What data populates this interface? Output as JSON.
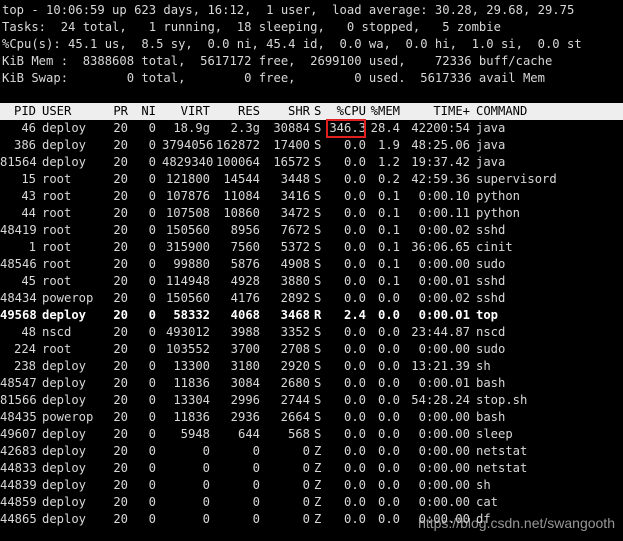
{
  "summary": {
    "line1": "top - 10:06:59 up 623 days, 16:12,  1 user,  load average: 30.28, 29.68, 29.75",
    "line2": "Tasks:  24 total,   1 running,  18 sleeping,   0 stopped,   5 zombie",
    "line3": "%Cpu(s): 45.1 us,  8.5 sy,  0.0 ni, 45.4 id,  0.0 wa,  0.0 hi,  1.0 si,  0.0 st",
    "line4": "KiB Mem :  8388608 total,  5617172 free,  2699100 used,    72336 buff/cache",
    "line5": "KiB Swap:        0 total,        0 free,        0 used.  5617336 avail Mem"
  },
  "columns": {
    "pid": "PID",
    "user": "USER",
    "pr": "PR",
    "ni": "NI",
    "virt": "VIRT",
    "res": "RES",
    "shr": "SHR",
    "s": "S",
    "cpu": "%CPU",
    "mem": "%MEM",
    "time": "TIME+",
    "command": "COMMAND"
  },
  "processes": [
    {
      "pid": "46",
      "user": "deploy",
      "pr": "20",
      "ni": "0",
      "virt": "18.9g",
      "res": "2.3g",
      "shr": "30884",
      "s": "S",
      "cpu": "346.3",
      "mem": "28.4",
      "time": "42200:54",
      "command": "java"
    },
    {
      "pid": "386",
      "user": "deploy",
      "pr": "20",
      "ni": "0",
      "virt": "3794056",
      "res": "162872",
      "shr": "17400",
      "s": "S",
      "cpu": "0.0",
      "mem": "1.9",
      "time": "48:25.06",
      "command": "java"
    },
    {
      "pid": "81564",
      "user": "deploy",
      "pr": "20",
      "ni": "0",
      "virt": "4829340",
      "res": "100064",
      "shr": "16572",
      "s": "S",
      "cpu": "0.0",
      "mem": "1.2",
      "time": "19:37.42",
      "command": "java"
    },
    {
      "pid": "15",
      "user": "root",
      "pr": "20",
      "ni": "0",
      "virt": "121800",
      "res": "14544",
      "shr": "3448",
      "s": "S",
      "cpu": "0.0",
      "mem": "0.2",
      "time": "42:59.36",
      "command": "supervisord"
    },
    {
      "pid": "43",
      "user": "root",
      "pr": "20",
      "ni": "0",
      "virt": "107876",
      "res": "11084",
      "shr": "3416",
      "s": "S",
      "cpu": "0.0",
      "mem": "0.1",
      "time": "0:00.10",
      "command": "python"
    },
    {
      "pid": "44",
      "user": "root",
      "pr": "20",
      "ni": "0",
      "virt": "107508",
      "res": "10860",
      "shr": "3472",
      "s": "S",
      "cpu": "0.0",
      "mem": "0.1",
      "time": "0:00.11",
      "command": "python"
    },
    {
      "pid": "48419",
      "user": "root",
      "pr": "20",
      "ni": "0",
      "virt": "150560",
      "res": "8956",
      "shr": "7672",
      "s": "S",
      "cpu": "0.0",
      "mem": "0.1",
      "time": "0:00.02",
      "command": "sshd"
    },
    {
      "pid": "1",
      "user": "root",
      "pr": "20",
      "ni": "0",
      "virt": "315900",
      "res": "7560",
      "shr": "5372",
      "s": "S",
      "cpu": "0.0",
      "mem": "0.1",
      "time": "36:06.65",
      "command": "cinit"
    },
    {
      "pid": "48546",
      "user": "root",
      "pr": "20",
      "ni": "0",
      "virt": "99880",
      "res": "5876",
      "shr": "4908",
      "s": "S",
      "cpu": "0.0",
      "mem": "0.1",
      "time": "0:00.00",
      "command": "sudo"
    },
    {
      "pid": "45",
      "user": "root",
      "pr": "20",
      "ni": "0",
      "virt": "114948",
      "res": "4928",
      "shr": "3880",
      "s": "S",
      "cpu": "0.0",
      "mem": "0.1",
      "time": "0:00.01",
      "command": "sshd"
    },
    {
      "pid": "48434",
      "user": "powerop",
      "pr": "20",
      "ni": "0",
      "virt": "150560",
      "res": "4176",
      "shr": "2892",
      "s": "S",
      "cpu": "0.0",
      "mem": "0.0",
      "time": "0:00.02",
      "command": "sshd"
    },
    {
      "pid": "49568",
      "user": "deploy",
      "pr": "20",
      "ni": "0",
      "virt": "58332",
      "res": "4068",
      "shr": "3468",
      "s": "R",
      "cpu": "2.4",
      "mem": "0.0",
      "time": "0:00.01",
      "command": "top"
    },
    {
      "pid": "48",
      "user": "nscd",
      "pr": "20",
      "ni": "0",
      "virt": "493012",
      "res": "3988",
      "shr": "3352",
      "s": "S",
      "cpu": "0.0",
      "mem": "0.0",
      "time": "23:44.87",
      "command": "nscd"
    },
    {
      "pid": "224",
      "user": "root",
      "pr": "20",
      "ni": "0",
      "virt": "103552",
      "res": "3700",
      "shr": "2708",
      "s": "S",
      "cpu": "0.0",
      "mem": "0.0",
      "time": "0:00.00",
      "command": "sudo"
    },
    {
      "pid": "238",
      "user": "deploy",
      "pr": "20",
      "ni": "0",
      "virt": "13300",
      "res": "3180",
      "shr": "2920",
      "s": "S",
      "cpu": "0.0",
      "mem": "0.0",
      "time": "13:21.39",
      "command": "sh"
    },
    {
      "pid": "48547",
      "user": "deploy",
      "pr": "20",
      "ni": "0",
      "virt": "11836",
      "res": "3084",
      "shr": "2680",
      "s": "S",
      "cpu": "0.0",
      "mem": "0.0",
      "time": "0:00.01",
      "command": "bash"
    },
    {
      "pid": "81566",
      "user": "deploy",
      "pr": "20",
      "ni": "0",
      "virt": "13304",
      "res": "2996",
      "shr": "2744",
      "s": "S",
      "cpu": "0.0",
      "mem": "0.0",
      "time": "54:28.24",
      "command": "stop.sh"
    },
    {
      "pid": "48435",
      "user": "powerop",
      "pr": "20",
      "ni": "0",
      "virt": "11836",
      "res": "2936",
      "shr": "2664",
      "s": "S",
      "cpu": "0.0",
      "mem": "0.0",
      "time": "0:00.00",
      "command": "bash"
    },
    {
      "pid": "49607",
      "user": "deploy",
      "pr": "20",
      "ni": "0",
      "virt": "5948",
      "res": "644",
      "shr": "568",
      "s": "S",
      "cpu": "0.0",
      "mem": "0.0",
      "time": "0:00.00",
      "command": "sleep"
    },
    {
      "pid": "42683",
      "user": "deploy",
      "pr": "20",
      "ni": "0",
      "virt": "0",
      "res": "0",
      "shr": "0",
      "s": "Z",
      "cpu": "0.0",
      "mem": "0.0",
      "time": "0:00.00",
      "command": "netstat"
    },
    {
      "pid": "44833",
      "user": "deploy",
      "pr": "20",
      "ni": "0",
      "virt": "0",
      "res": "0",
      "shr": "0",
      "s": "Z",
      "cpu": "0.0",
      "mem": "0.0",
      "time": "0:00.00",
      "command": "netstat"
    },
    {
      "pid": "44839",
      "user": "deploy",
      "pr": "20",
      "ni": "0",
      "virt": "0",
      "res": "0",
      "shr": "0",
      "s": "Z",
      "cpu": "0.0",
      "mem": "0.0",
      "time": "0:00.00",
      "command": "sh"
    },
    {
      "pid": "44859",
      "user": "deploy",
      "pr": "20",
      "ni": "0",
      "virt": "0",
      "res": "0",
      "shr": "0",
      "s": "Z",
      "cpu": "0.0",
      "mem": "0.0",
      "time": "0:00.00",
      "command": "cat"
    },
    {
      "pid": "44865",
      "user": "deploy",
      "pr": "20",
      "ni": "0",
      "virt": "0",
      "res": "0",
      "shr": "0",
      "s": "Z",
      "cpu": "0.0",
      "mem": "0.0",
      "time": "0:00.00",
      "command": "df"
    }
  ],
  "bold_row_pid": "49568",
  "highlight_color": "#e02020",
  "header_bg": "#eeeeee",
  "watermark": "https://blog.csdn.net/swangooth"
}
